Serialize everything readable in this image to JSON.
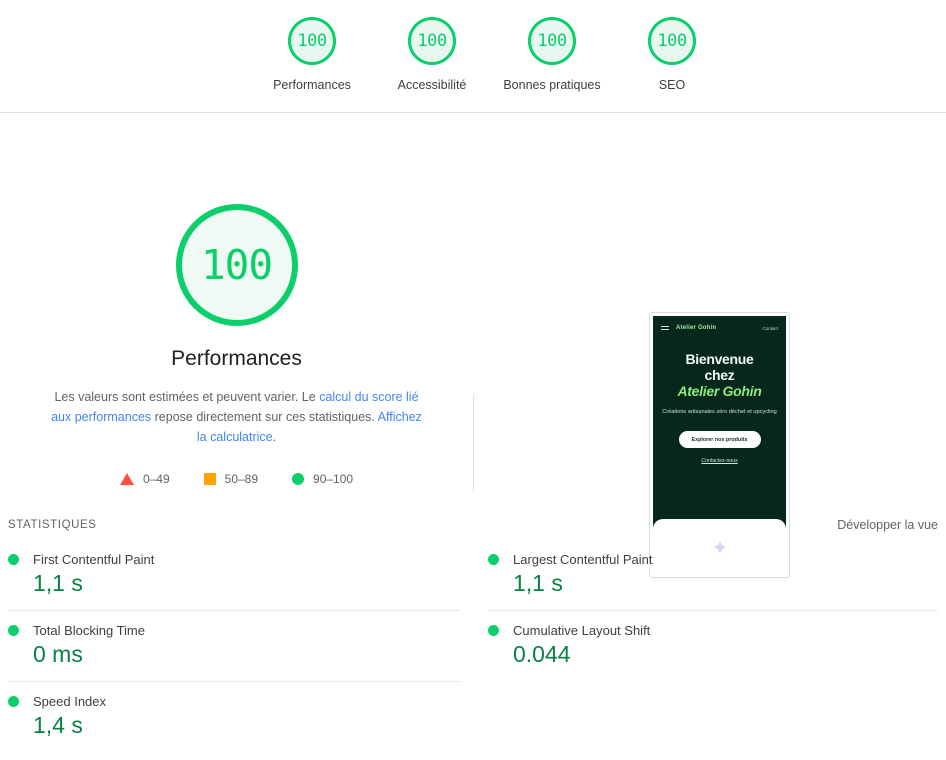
{
  "category_gauges": [
    {
      "score": "100",
      "label": "Performances",
      "icon": "score-gauge-icon"
    },
    {
      "score": "100",
      "label": "Accessibilité",
      "icon": "score-gauge-icon"
    },
    {
      "score": "100",
      "label": "Bonnes pratiques",
      "icon": "score-gauge-icon"
    },
    {
      "score": "100",
      "label": "SEO",
      "icon": "score-gauge-icon"
    }
  ],
  "hero": {
    "score": "100",
    "title": "Performances",
    "description": {
      "part1": "Les valeurs sont estimées et peuvent varier. Le ",
      "link1": "calcul du score lié aux performances",
      "part2": " repose directement sur ces statistiques. ",
      "link2": "Affichez la calculatrice",
      "part3": "."
    }
  },
  "legend": [
    {
      "shape": "triangle",
      "range": "0–49",
      "color": "#ff4e42"
    },
    {
      "shape": "square",
      "range": "50–89",
      "color": "#ffa400"
    },
    {
      "shape": "circle",
      "range": "90–100",
      "color": "#0cce6b"
    }
  ],
  "thumbnail": {
    "brand": "Atelier Gohin",
    "nav_link": "Contact",
    "headline_line1": "Bienvenue",
    "headline_line2": "chez",
    "headline_accent": "Atelier Gohin",
    "subtitle": "Créations artisanales zéro déchet et upcycling",
    "cta": "Explorer nos produits",
    "secondary_link": "Contactez-nous"
  },
  "metrics_section": {
    "title": "STATISTIQUES",
    "expand_label": "Développer la vue",
    "left_column": [
      {
        "name": "First Contentful Paint",
        "value": "1,1 s",
        "status": "good"
      },
      {
        "name": "Total Blocking Time",
        "value": "0 ms",
        "status": "good"
      },
      {
        "name": "Speed Index",
        "value": "1,4 s",
        "status": "good"
      }
    ],
    "right_column": [
      {
        "name": "Largest Contentful Paint",
        "value": "1,1 s",
        "status": "good"
      },
      {
        "name": "Cumulative Layout Shift",
        "value": "0.044",
        "status": "good"
      }
    ]
  },
  "colors": {
    "good": "#0cce6b",
    "average": "#ffa400",
    "poor": "#ff4e42",
    "value_text": "#0b8043",
    "link": "#4285f4"
  }
}
